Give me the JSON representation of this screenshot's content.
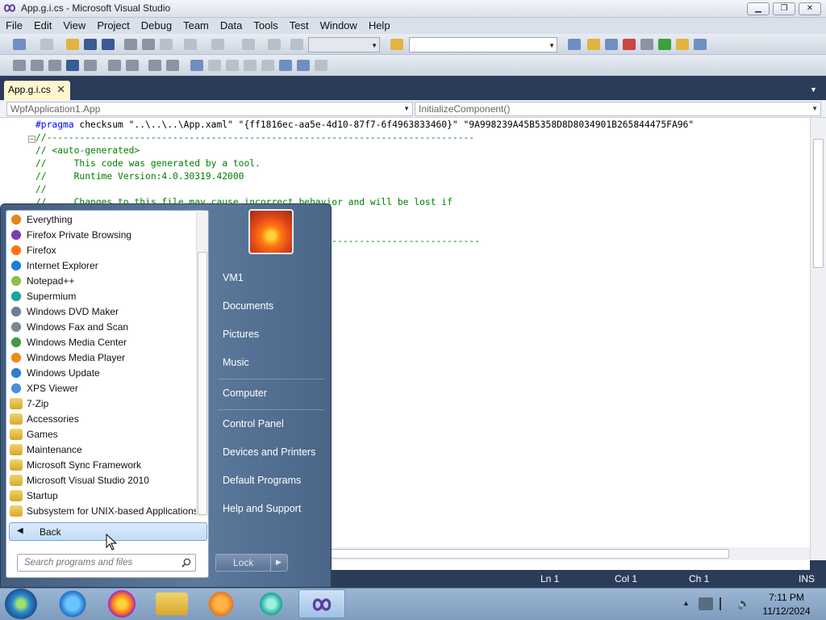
{
  "window": {
    "title": "App.g.i.cs - Microsoft Visual Studio"
  },
  "menu": [
    "File",
    "Edit",
    "View",
    "Project",
    "Debug",
    "Team",
    "Data",
    "Tools",
    "Test",
    "Window",
    "Help"
  ],
  "doc_tab": {
    "label": "App.g.i.cs"
  },
  "navbar": {
    "left": "WpfApplication1.App",
    "right": "InitializeComponent()"
  },
  "code": {
    "line1_kw": "#pragma",
    "line1_plain": " checksum ",
    "line1_str": "\"..\\..\\..\\App.xaml\" \"{ff1816ec-aa5e-4d10-87f7-6f4963833460}\" \"9A998239A45B5358D8D8034901B265844475FA96\"",
    "line2": "//------------------------------------------------------------------------------",
    "line3": "// <auto-generated>",
    "line4": "//     This code was generated by a tool.",
    "line5": "//     Runtime Version:4.0.30319.42000",
    "line6": "//",
    "line7": "//     Changes to this file may cause incorrect behavior and will be lost if",
    "line9": "// ------------------------------------------------------------------------------"
  },
  "status": {
    "ln": "Ln 1",
    "col": "Col 1",
    "ch": "Ch 1",
    "mode": "INS"
  },
  "start_menu": {
    "programs": [
      {
        "label": "Everything",
        "icon": "search-icon",
        "color": "#e2871c"
      },
      {
        "label": "Firefox Private Browsing",
        "icon": "mask-icon",
        "color": "#7a3fb5"
      },
      {
        "label": "Firefox",
        "icon": "firefox-icon",
        "color": "#ff7417"
      },
      {
        "label": "Internet Explorer",
        "icon": "ie-icon",
        "color": "#1f7cd6"
      },
      {
        "label": "Notepad++",
        "icon": "notepad-icon",
        "color": "#8cbf4a"
      },
      {
        "label": "Supermium",
        "icon": "supermium-icon",
        "color": "#1aa59a"
      },
      {
        "label": "Windows DVD Maker",
        "icon": "dvd-icon",
        "color": "#6d7f95"
      },
      {
        "label": "Windows Fax and Scan",
        "icon": "fax-icon",
        "color": "#7b8794"
      },
      {
        "label": "Windows Media Center",
        "icon": "media-center-icon",
        "color": "#3f9c3f"
      },
      {
        "label": "Windows Media Player",
        "icon": "media-player-icon",
        "color": "#f08a1b"
      },
      {
        "label": "Windows Update",
        "icon": "update-icon",
        "color": "#2d7fcf"
      },
      {
        "label": "XPS Viewer",
        "icon": "xps-icon",
        "color": "#4a8fd8"
      },
      {
        "label": "7-Zip",
        "icon": "folder-icon",
        "color": "#e3b440"
      },
      {
        "label": "Accessories",
        "icon": "folder-icon",
        "color": "#e3b440"
      },
      {
        "label": "Games",
        "icon": "folder-icon",
        "color": "#e3b440"
      },
      {
        "label": "Maintenance",
        "icon": "folder-icon",
        "color": "#e3b440"
      },
      {
        "label": "Microsoft Sync Framework",
        "icon": "folder-icon",
        "color": "#e3b440"
      },
      {
        "label": "Microsoft Visual Studio 2010",
        "icon": "folder-icon",
        "color": "#e3b440"
      },
      {
        "label": "Startup",
        "icon": "folder-icon",
        "color": "#e3b440"
      },
      {
        "label": "Subsystem for UNIX-based Applications",
        "icon": "folder-icon",
        "color": "#e3b440"
      }
    ],
    "back_label": "Back",
    "search_placeholder": "Search programs and files",
    "right_links": [
      "VM1",
      "Documents",
      "Pictures",
      "Music",
      "Computer",
      "Control Panel",
      "Devices and Printers",
      "Default Programs",
      "Help and Support"
    ],
    "lock_label": "Lock"
  },
  "clock": {
    "time": "7:11 PM",
    "date": "11/12/2024"
  }
}
